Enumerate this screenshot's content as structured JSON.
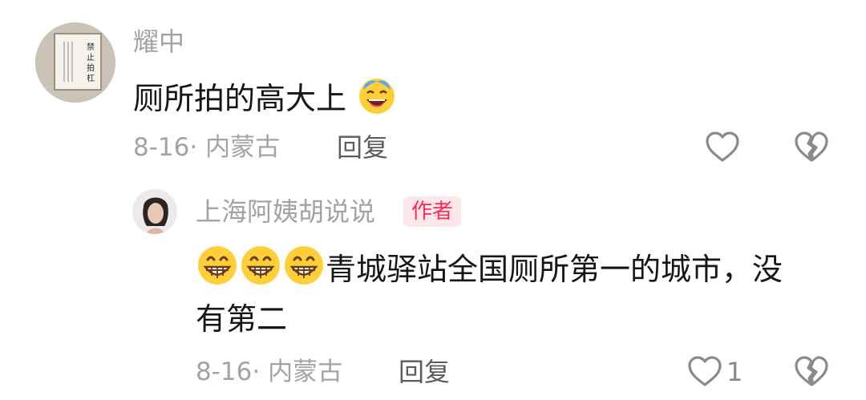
{
  "comment": {
    "username": "耀中",
    "text": "厕所拍的高大上",
    "emoji_icon": "laughing-tears-emoji-icon",
    "meta": "8-16· 内蒙古",
    "reply_label": "回复",
    "avatar_text": "禁止拍杠"
  },
  "reply": {
    "username": "上海阿姨胡说说",
    "badge": "作者",
    "emoji_icon": "grinning-face-emoji-icon",
    "emoji_count": 3,
    "text_line1": "青城驿站全国厕所第一的城市，没",
    "text_line2": "有第二",
    "meta": "8-16· 内蒙古",
    "reply_label": "回复",
    "like_count": "1"
  },
  "colors": {
    "text_primary": "#161616",
    "text_secondary": "#a3a3a3",
    "badge_bg": "#fde7eb",
    "badge_text": "#fe2c55",
    "icon": "#8a8a8a"
  }
}
